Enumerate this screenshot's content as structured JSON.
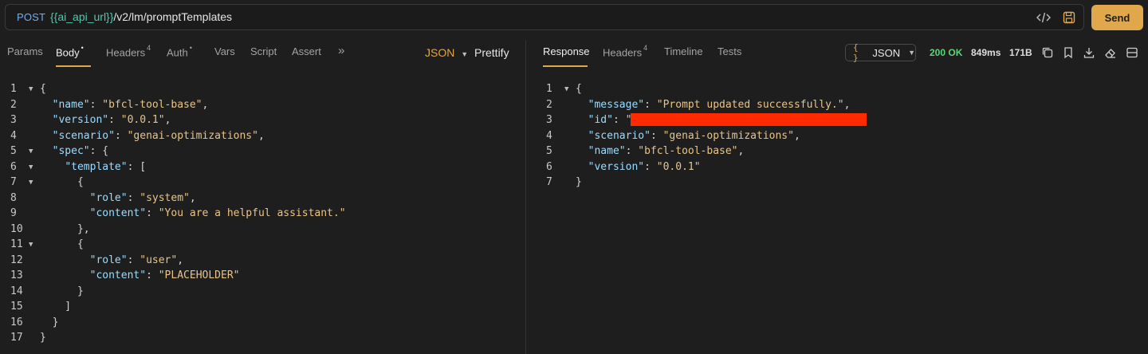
{
  "request": {
    "method": "POST",
    "url_var": "{{ai_api_url}}",
    "url_path": "/v2/lm/promptTemplates",
    "send_label": "Send"
  },
  "left_tabs": [
    {
      "label": "Params",
      "badge": ""
    },
    {
      "label": "Body",
      "badge": "•"
    },
    {
      "label": "Headers",
      "badge": "4"
    },
    {
      "label": "Auth",
      "badge": "•"
    },
    {
      "label": "Vars",
      "badge": ""
    },
    {
      "label": "Script",
      "badge": ""
    },
    {
      "label": "Assert",
      "badge": ""
    }
  ],
  "left_more": "»",
  "body_format": "JSON",
  "prettify_label": "Prettify",
  "right_tabs": [
    {
      "label": "Response",
      "badge": ""
    },
    {
      "label": "Headers",
      "badge": "4"
    },
    {
      "label": "Timeline",
      "badge": ""
    },
    {
      "label": "Tests",
      "badge": ""
    }
  ],
  "response_format": "JSON",
  "response_format_icon": "{ }",
  "status": "200 OK",
  "time": "849ms",
  "size": "171B",
  "colors": {
    "accent": "#e0a84a",
    "ok": "#5bd67a",
    "key": "#9cdcfe",
    "string": "#e8c48a",
    "redaction": "#ff2a00"
  },
  "request_body": [
    {
      "n": "1",
      "fold": true,
      "parts": [
        {
          "t": "{",
          "c": "p"
        }
      ]
    },
    {
      "n": "2",
      "fold": false,
      "parts": [
        {
          "t": "  ",
          "c": "p"
        },
        {
          "t": "\"name\"",
          "c": "k"
        },
        {
          "t": ": ",
          "c": "p"
        },
        {
          "t": "\"bfcl-tool-base\"",
          "c": "s"
        },
        {
          "t": ",",
          "c": "p"
        }
      ]
    },
    {
      "n": "3",
      "fold": false,
      "parts": [
        {
          "t": "  ",
          "c": "p"
        },
        {
          "t": "\"version\"",
          "c": "k"
        },
        {
          "t": ": ",
          "c": "p"
        },
        {
          "t": "\"0.0.1\"",
          "c": "s"
        },
        {
          "t": ",",
          "c": "p"
        }
      ]
    },
    {
      "n": "4",
      "fold": false,
      "parts": [
        {
          "t": "  ",
          "c": "p"
        },
        {
          "t": "\"scenario\"",
          "c": "k"
        },
        {
          "t": ": ",
          "c": "p"
        },
        {
          "t": "\"genai-optimizations\"",
          "c": "s"
        },
        {
          "t": ",",
          "c": "p"
        }
      ]
    },
    {
      "n": "5",
      "fold": true,
      "parts": [
        {
          "t": "  ",
          "c": "p"
        },
        {
          "t": "\"spec\"",
          "c": "k"
        },
        {
          "t": ": {",
          "c": "p"
        }
      ]
    },
    {
      "n": "6",
      "fold": true,
      "parts": [
        {
          "t": "    ",
          "c": "p"
        },
        {
          "t": "\"template\"",
          "c": "k"
        },
        {
          "t": ": [",
          "c": "p"
        }
      ]
    },
    {
      "n": "7",
      "fold": true,
      "parts": [
        {
          "t": "      {",
          "c": "p"
        }
      ]
    },
    {
      "n": "8",
      "fold": false,
      "parts": [
        {
          "t": "        ",
          "c": "p"
        },
        {
          "t": "\"role\"",
          "c": "k"
        },
        {
          "t": ": ",
          "c": "p"
        },
        {
          "t": "\"system\"",
          "c": "s"
        },
        {
          "t": ",",
          "c": "p"
        }
      ]
    },
    {
      "n": "9",
      "fold": false,
      "parts": [
        {
          "t": "        ",
          "c": "p"
        },
        {
          "t": "\"content\"",
          "c": "k"
        },
        {
          "t": ": ",
          "c": "p"
        },
        {
          "t": "\"You are a helpful assistant.\"",
          "c": "s"
        }
      ]
    },
    {
      "n": "10",
      "fold": false,
      "parts": [
        {
          "t": "      },",
          "c": "p"
        }
      ]
    },
    {
      "n": "11",
      "fold": true,
      "parts": [
        {
          "t": "      {",
          "c": "p"
        }
      ]
    },
    {
      "n": "12",
      "fold": false,
      "parts": [
        {
          "t": "        ",
          "c": "p"
        },
        {
          "t": "\"role\"",
          "c": "k"
        },
        {
          "t": ": ",
          "c": "p"
        },
        {
          "t": "\"user\"",
          "c": "s"
        },
        {
          "t": ",",
          "c": "p"
        }
      ]
    },
    {
      "n": "13",
      "fold": false,
      "parts": [
        {
          "t": "        ",
          "c": "p"
        },
        {
          "t": "\"content\"",
          "c": "k"
        },
        {
          "t": ": ",
          "c": "p"
        },
        {
          "t": "\"PLACEHOLDER\"",
          "c": "s"
        }
      ]
    },
    {
      "n": "14",
      "fold": false,
      "parts": [
        {
          "t": "      }",
          "c": "p"
        }
      ]
    },
    {
      "n": "15",
      "fold": false,
      "parts": [
        {
          "t": "    ]",
          "c": "p"
        }
      ]
    },
    {
      "n": "16",
      "fold": false,
      "parts": [
        {
          "t": "  }",
          "c": "p"
        }
      ]
    },
    {
      "n": "17",
      "fold": false,
      "parts": [
        {
          "t": "}",
          "c": "p"
        }
      ]
    }
  ],
  "response_body": [
    {
      "n": "1",
      "fold": true,
      "parts": [
        {
          "t": "{",
          "c": "p"
        }
      ]
    },
    {
      "n": "2",
      "fold": false,
      "parts": [
        {
          "t": "  ",
          "c": "p"
        },
        {
          "t": "\"message\"",
          "c": "k"
        },
        {
          "t": ": ",
          "c": "p"
        },
        {
          "t": "\"Prompt updated successfully.\"",
          "c": "s"
        },
        {
          "t": ",",
          "c": "p"
        }
      ]
    },
    {
      "n": "3",
      "fold": false,
      "parts": [
        {
          "t": "  ",
          "c": "p"
        },
        {
          "t": "\"id\"",
          "c": "k"
        },
        {
          "t": ": ",
          "c": "p"
        },
        {
          "t": "\"",
          "c": "s"
        }
      ]
    },
    {
      "n": "4",
      "fold": false,
      "parts": [
        {
          "t": "  ",
          "c": "p"
        },
        {
          "t": "\"scenario\"",
          "c": "k"
        },
        {
          "t": ": ",
          "c": "p"
        },
        {
          "t": "\"genai-optimizations\"",
          "c": "s"
        },
        {
          "t": ",",
          "c": "p"
        }
      ]
    },
    {
      "n": "5",
      "fold": false,
      "parts": [
        {
          "t": "  ",
          "c": "p"
        },
        {
          "t": "\"name\"",
          "c": "k"
        },
        {
          "t": ": ",
          "c": "p"
        },
        {
          "t": "\"bfcl-tool-base\"",
          "c": "s"
        },
        {
          "t": ",",
          "c": "p"
        }
      ]
    },
    {
      "n": "6",
      "fold": false,
      "parts": [
        {
          "t": "  ",
          "c": "p"
        },
        {
          "t": "\"version\"",
          "c": "k"
        },
        {
          "t": ": ",
          "c": "p"
        },
        {
          "t": "\"0.0.1\"",
          "c": "s"
        }
      ]
    },
    {
      "n": "7",
      "fold": false,
      "parts": [
        {
          "t": "}",
          "c": "p"
        }
      ]
    }
  ]
}
